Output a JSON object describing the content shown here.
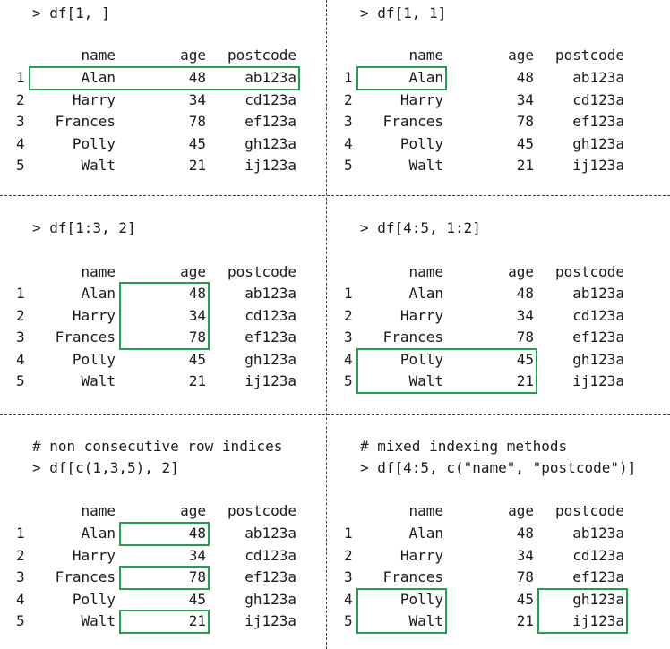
{
  "panels": [
    {
      "comment": "",
      "command": "> df[1, ]"
    },
    {
      "comment": "",
      "command": "> df[1, 1]"
    },
    {
      "comment": "",
      "command": "> df[1:3, 2]"
    },
    {
      "comment": "",
      "command": "> df[4:5, 1:2]"
    },
    {
      "comment": "# non consecutive row indices",
      "command": "> df[c(1,3,5), 2]"
    },
    {
      "comment": "# mixed indexing methods",
      "command": "> df[4:5, c(\"name\", \"postcode\")]"
    }
  ],
  "table": {
    "headers": [
      "name",
      "age",
      "postcode"
    ],
    "rows": [
      {
        "idx": "1",
        "name": "Alan",
        "age": "48",
        "postcode": "ab123a"
      },
      {
        "idx": "2",
        "name": "Harry",
        "age": "34",
        "postcode": "cd123a"
      },
      {
        "idx": "3",
        "name": "Frances",
        "age": "78",
        "postcode": "ef123a"
      },
      {
        "idx": "4",
        "name": "Polly",
        "age": "45",
        "postcode": "gh123a"
      },
      {
        "idx": "5",
        "name": "Walt",
        "age": "21",
        "postcode": "ij123a"
      }
    ]
  },
  "highlights": [
    [
      {
        "rows": [
          1,
          1
        ],
        "cols": [
          "name",
          "postcode"
        ]
      }
    ],
    [
      {
        "rows": [
          1,
          1
        ],
        "cols": [
          "name",
          "name"
        ]
      }
    ],
    [
      {
        "rows": [
          1,
          3
        ],
        "cols": [
          "age",
          "age"
        ]
      }
    ],
    [
      {
        "rows": [
          4,
          5
        ],
        "cols": [
          "name",
          "age"
        ]
      }
    ],
    [
      {
        "rows": [
          1,
          1
        ],
        "cols": [
          "age",
          "age"
        ]
      },
      {
        "rows": [
          3,
          3
        ],
        "cols": [
          "age",
          "age"
        ]
      },
      {
        "rows": [
          5,
          5
        ],
        "cols": [
          "age",
          "age"
        ]
      }
    ],
    [
      {
        "rows": [
          4,
          5
        ],
        "cols": [
          "name",
          "name"
        ]
      },
      {
        "rows": [
          4,
          5
        ],
        "cols": [
          "postcode",
          "postcode"
        ]
      }
    ]
  ],
  "highlight_color": "#22a050"
}
